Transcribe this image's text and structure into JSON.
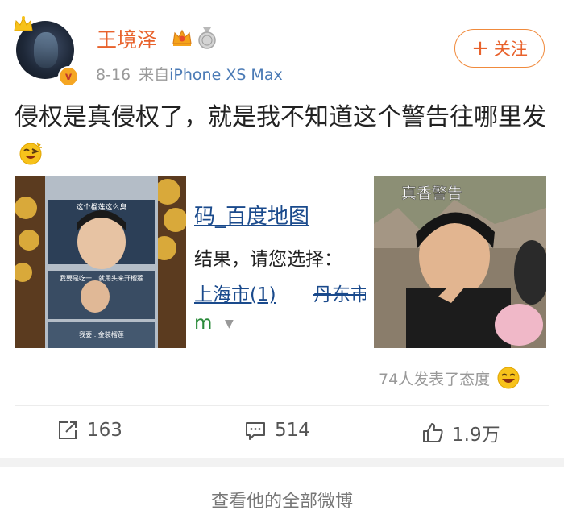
{
  "post": {
    "username": "王境泽",
    "date": "8-16",
    "source_prefix": "来自",
    "device": "iPhone XS Max",
    "follow_label": "关注",
    "text": "侵权是真侵权了，就是我不知道这个警告往哪里发",
    "images": [
      {
        "captions": [
          "这个榴莲这么臭",
          "我要是吃一口就用头来开榴莲",
          "我要...金装榴莲"
        ]
      },
      {
        "lines": [
          "码_百度地图",
          "结果，请您选择：",
          "上海市(1)",
          "丹东市",
          "m"
        ]
      },
      {
        "caption": "真香警告"
      }
    ],
    "reactions_text": "74人发表了态度"
  },
  "actions": {
    "repost": "163",
    "comment": "514",
    "like": "1.9万"
  },
  "footer": {
    "view_all": "查看他的全部微博"
  },
  "colors": {
    "username": "#e8622c",
    "device_link": "#4a7ab5",
    "follow_border": "#f08a3c",
    "meta_gray": "#9a9a9a"
  },
  "icons": [
    "crown-icon",
    "verified-v-icon",
    "vip-crown-icon",
    "medal-icon",
    "plus-icon",
    "laugh-emoji-icon",
    "repost-icon",
    "comment-icon",
    "like-icon"
  ]
}
